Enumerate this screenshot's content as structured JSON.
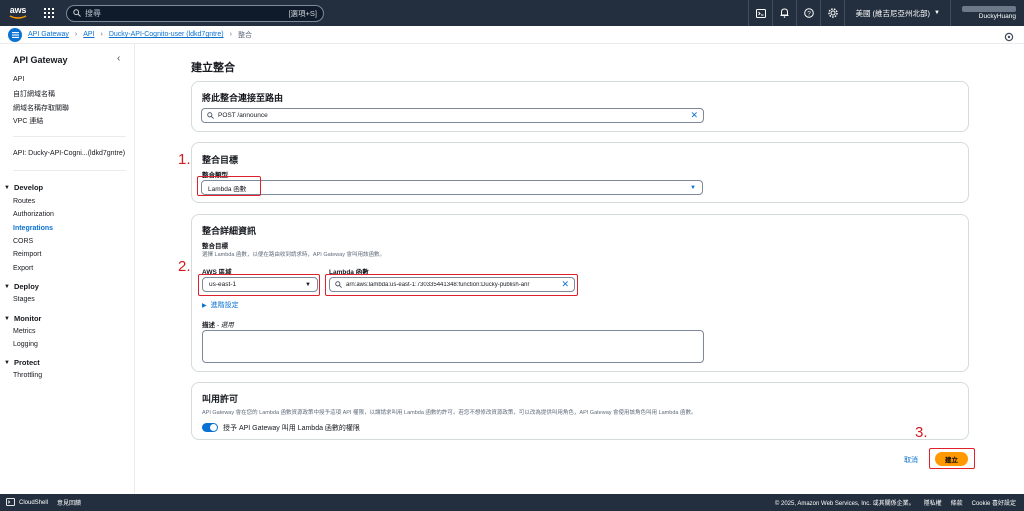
{
  "topnav": {
    "logo_text": "aws",
    "search_placeholder": "搜尋",
    "search_shortcut": "[選項+S]",
    "region": "美國 (維吉尼亞州北部)",
    "account_name": "DuckyHuang"
  },
  "breadcrumb": {
    "items": [
      "API Gateway",
      "API",
      "Ducky-API-Cognito-user (ldkd7gntre)"
    ],
    "current": "整合"
  },
  "sidebar": {
    "title": "API Gateway",
    "top_links": [
      "API",
      "自訂網域名稱",
      "網域名稱存取關聯",
      "VPC 連結"
    ],
    "api_label": "API: Ducky-API-Cogni...(ldkd7gntre)",
    "develop": {
      "label": "Develop",
      "items": [
        "Routes",
        "Authorization",
        "Integrations",
        "CORS",
        "Reimport",
        "Export"
      ]
    },
    "deploy": {
      "label": "Deploy",
      "items": [
        "Stages"
      ]
    },
    "monitor": {
      "label": "Monitor",
      "items": [
        "Metrics",
        "Logging"
      ]
    },
    "protect": {
      "label": "Protect",
      "items": [
        "Throttling"
      ]
    }
  },
  "main": {
    "page_title": "建立整合",
    "route_card": {
      "heading": "將此整合連接至路由",
      "route_value": "POST /announce"
    },
    "target_card": {
      "heading": "整合目標",
      "type_label": "整合類型",
      "type_value": "Lambda 函數"
    },
    "details_card": {
      "heading": "整合詳細資訊",
      "target_label": "整合目標",
      "target_desc": "選擇 Lambda 函數，以便在路由收到請求時，API Gateway 會叫用該函數。",
      "region_label": "AWS 區域",
      "region_value": "us-east-1",
      "lambda_label": "Lambda 函數",
      "lambda_value": "arn:aws:lambda:us-east-1:730335441348:function:Ducky-publish-anr",
      "advanced_label": "進階設定",
      "desc_label": "描述",
      "desc_optional": "- 選用"
    },
    "permission_card": {
      "heading": "叫用許可",
      "desc": "API Gateway 會在您的 Lambda 函數資源政策中授予這項 API 權限，以讓請求叫用 Lambda 函數的許可。若您不想修改資源政策，可以改為提供叫用角色，API Gateway 會使用該角色叫用 Lambda 函數。",
      "toggle_label": "授予 API Gateway 叫用 Lambda 函數的權限"
    },
    "cancel_label": "取消",
    "create_label": "建立",
    "annotations": [
      "1.",
      "2.",
      "3."
    ]
  },
  "footer": {
    "cloudshell": "CloudShell",
    "feedback": "意見回饋",
    "copyright": "© 2025, Amazon Web Services, Inc. 或其關係企業。",
    "privacy": "隱私權",
    "terms": "條款",
    "cookie": "Cookie 喜好設定"
  },
  "colors": {
    "nav_bg": "#232f3e",
    "link": "#0972d3",
    "primary_button": "#ff9900",
    "annotation_red": "#e0202a"
  }
}
